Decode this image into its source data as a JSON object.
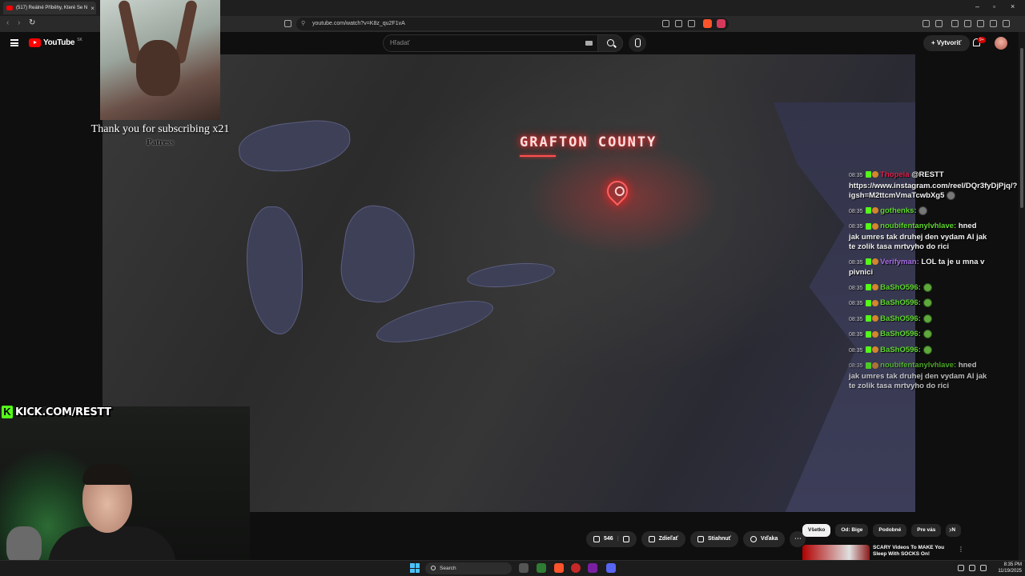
{
  "browser": {
    "tab_title": "(517) Reálné Příběhy, Které Se N",
    "tab_close": "×",
    "url": "youtube.com/watch?v=K8z_qu2F1vA",
    "win_min": "–",
    "win_max": "▫",
    "win_close": "×",
    "nav_back": "‹",
    "nav_forward": "›",
    "reload": "↻"
  },
  "youtube": {
    "logo_text": "YouTube",
    "logo_region": "SK",
    "search_placeholder": "Hľadať",
    "create_label": "Vytvoriť",
    "notification_badge": "9+"
  },
  "video_overlay": {
    "county_label": "GRAFTON COUNTY"
  },
  "stream_overlay": {
    "alert_text": "Thank you for subscribing x21",
    "alert_name": "Patress",
    "kick_url": "KICK.COM/RESTT"
  },
  "chat": [
    {
      "time": "08:35",
      "user": "Thopeia",
      "color": "#e0204a",
      "text": "@RESTT https://www.instagram.com/reel/DQr3fyDjPjq/?igsh=M2ttcmVmaTcwbXg5",
      "emote": "grey"
    },
    {
      "time": "08:35",
      "user": "gothenks:",
      "color": "#5fd82c",
      "text": "",
      "emote": "grey"
    },
    {
      "time": "08:35",
      "user": "noubifentanylvhlave:",
      "color": "#5fd82c",
      "text": "hned jak umres tak druhej den vydam AI jak te zolik tasa mrtvyho do rici",
      "emote": ""
    },
    {
      "time": "08:35",
      "user": "Verifyman:",
      "color": "#a86ee6",
      "text": "LOL ta je u mna v pivnici",
      "emote": ""
    },
    {
      "time": "08:35",
      "user": "BaShO596:",
      "color": "#5fd82c",
      "text": "",
      "emote": "green"
    },
    {
      "time": "08:35",
      "user": "BaShO596:",
      "color": "#5fd82c",
      "text": "",
      "emote": "green"
    },
    {
      "time": "08:35",
      "user": "BaShO596:",
      "color": "#5fd82c",
      "text": "",
      "emote": "green"
    },
    {
      "time": "08:35",
      "user": "BaShO596:",
      "color": "#5fd82c",
      "text": "",
      "emote": "green"
    },
    {
      "time": "08:35",
      "user": "BaShO596:",
      "color": "#5fd82c",
      "text": "",
      "emote": "green"
    },
    {
      "time": "08:35",
      "user": "noubifentanylvhlave:",
      "color": "#5fd82c",
      "text": "hned jak umres tak druhej den vydam AI jak te zolik tasa mrtvyho do rici",
      "emote": ""
    }
  ],
  "actions": {
    "like_count": "546",
    "share_label": "Zdieľať",
    "download_label": "Stiahnuť",
    "thanks_label": "Vďaka",
    "more_label": "⋯"
  },
  "chips": [
    "Všetko",
    "Od: Bige",
    "Podobné",
    "Pre vás",
    "N"
  ],
  "recommendation": {
    "title": "SCARY Videos To MAKE You Sleep With SOCKS On!",
    "menu": "⋮"
  },
  "taskbar": {
    "search_label": "Search",
    "time": "8:35 PM",
    "date": "11/19/2025"
  },
  "colors": {
    "accent_red": "#ff0000",
    "kick_green": "#53fc18",
    "county_glow": "#ff3030"
  }
}
